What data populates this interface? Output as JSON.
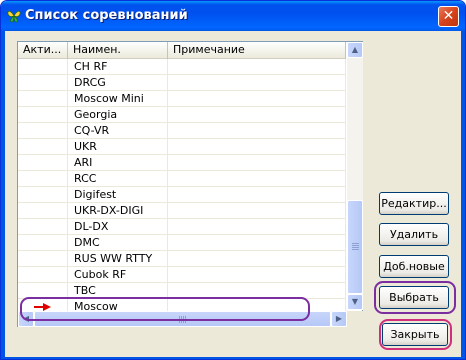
{
  "window": {
    "title": "Список соревнований",
    "close_glyph": "✕",
    "title_icon": "butterfly-icon"
  },
  "list": {
    "columns": [
      "Акти...",
      "Наимен.",
      "Примечание"
    ],
    "rows": [
      {
        "active": "",
        "name": "CH RF",
        "note": ""
      },
      {
        "active": "",
        "name": "DRCG",
        "note": ""
      },
      {
        "active": "",
        "name": "Moscow Mini",
        "note": ""
      },
      {
        "active": "",
        "name": "Georgia",
        "note": ""
      },
      {
        "active": "",
        "name": "CQ-VR",
        "note": ""
      },
      {
        "active": "",
        "name": "UKR",
        "note": ""
      },
      {
        "active": "",
        "name": "ARI",
        "note": ""
      },
      {
        "active": "",
        "name": "RCC",
        "note": ""
      },
      {
        "active": "",
        "name": "Digifest",
        "note": ""
      },
      {
        "active": "",
        "name": "UKR-DX-DIGI",
        "note": ""
      },
      {
        "active": "",
        "name": "DL-DX",
        "note": ""
      },
      {
        "active": "",
        "name": "DMC",
        "note": ""
      },
      {
        "active": "",
        "name": "RUS WW RTTY",
        "note": ""
      },
      {
        "active": "",
        "name": "Cubok RF",
        "note": ""
      },
      {
        "active": "",
        "name": "TBC",
        "note": ""
      },
      {
        "active": "",
        "name": "Moscow",
        "note": ""
      }
    ],
    "highlighted_row": "Moscow",
    "pointer_icon": "red-arrow-icon"
  },
  "buttons": {
    "edit": "Редактир...",
    "delete": "Удалить",
    "add_new": "Доб.новые",
    "select": "Выбрать",
    "close": "Закрыть"
  },
  "colors": {
    "title_bar": "#0055e5",
    "highlight_purple": "#7a2ea0",
    "highlight_pink": "#d0307a",
    "arrow_red": "#e00000"
  }
}
